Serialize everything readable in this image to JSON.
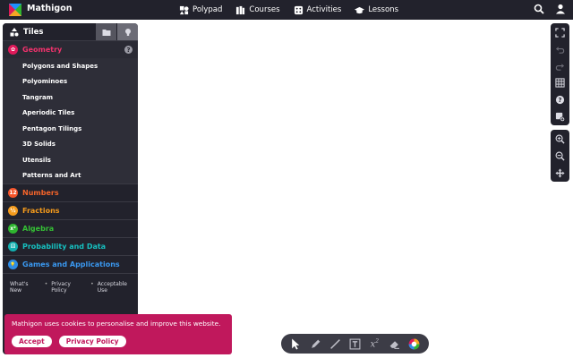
{
  "topbar": {
    "brand": "Mathigon",
    "nav": [
      {
        "label": "Polypad",
        "icon": "polypad-icon"
      },
      {
        "label": "Courses",
        "icon": "courses-icon"
      },
      {
        "label": "Activities",
        "icon": "activities-icon"
      },
      {
        "label": "Lessons",
        "icon": "lessons-icon"
      }
    ],
    "actions": [
      {
        "icon": "search-icon"
      },
      {
        "icon": "account-icon"
      }
    ]
  },
  "sidebar": {
    "title": "Tiles",
    "categories": [
      {
        "label": "Geometry",
        "color": "#e0195a",
        "badge": "✿",
        "expanded": true
      },
      {
        "label": "Numbers",
        "color": "#f5542a",
        "badge": "12"
      },
      {
        "label": "Fractions",
        "color": "#f59b1c",
        "badge": "½"
      },
      {
        "label": "Algebra",
        "color": "#2fb52f",
        "badge": "x²"
      },
      {
        "label": "Probability and Data",
        "color": "#12b0b0",
        "badge": "⚄"
      },
      {
        "label": "Games and Applications",
        "color": "#2e8de6",
        "badge": "💡"
      }
    ],
    "geometry_items": [
      "Polygons and Shapes",
      "Polyominoes",
      "Tangram",
      "Aperiodic Tiles",
      "Pentagon Tilings",
      "3D Solids",
      "Utensils",
      "Patterns and Art"
    ],
    "footer": [
      "What's New",
      "Privacy Policy",
      "Acceptable Use"
    ],
    "footer_sep": "•"
  },
  "cookie": {
    "message": "Mathigon uses cookies to personalise and improve this website.",
    "accept": "Accept",
    "privacy": "Privacy Policy"
  },
  "bottom_tools": {
    "superscript": "x",
    "superscript_power": "2"
  },
  "colors": {
    "accent": "#c0185c",
    "dark": "#22222c"
  }
}
